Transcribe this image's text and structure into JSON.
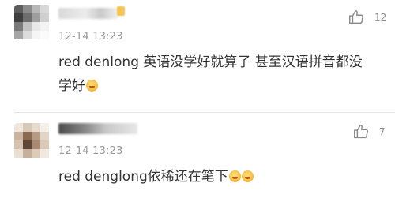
{
  "comments": [
    {
      "time": "12-14 13:23",
      "text": "red denlong 英语没学好就算了 甚至汉语拼音都没学好",
      "text_line1": "red denlong 英语没学好就算了 甚至汉语拼音都没",
      "text_line2": "学好",
      "emojis": [
        "laughing-crying-emoji"
      ],
      "likes": "12"
    },
    {
      "time": "12-14 13:23",
      "text": "red denglong依稀还在笔下",
      "emojis": [
        "wow-emoji",
        "wow-emoji"
      ],
      "likes": "7"
    }
  ],
  "icons": {
    "like": "thumbs-up-icon"
  },
  "colors": {
    "text": "#333333",
    "meta": "#9a9a9a",
    "icon": "#8a8a8a",
    "divider": "#e6e6e6",
    "emoji": "#f5b53a"
  }
}
